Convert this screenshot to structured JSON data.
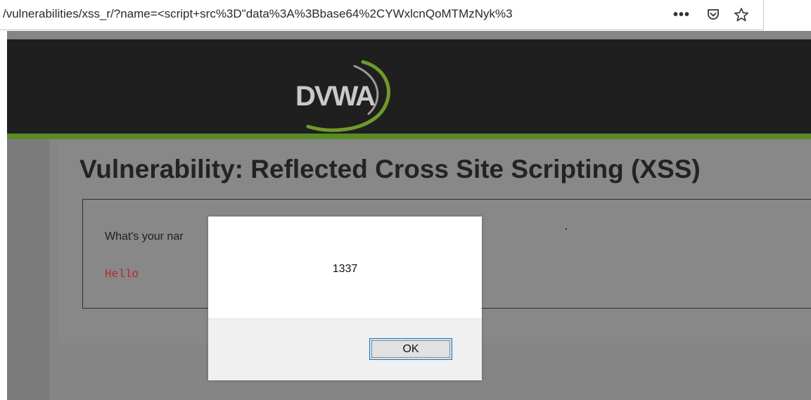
{
  "browser": {
    "url": "/vulnerabilities/xss_r/?name=<script+src%3D\"data%3A%3Bbase64%2CYWxlcnQoMTMzNyk%3",
    "icons": {
      "more": "more-actions-icon",
      "pocket": "pocket-icon",
      "bookmark": "bookmark-star-icon"
    }
  },
  "header": {
    "logo_text": "DVWA",
    "colors": {
      "bar": "#1f1f1f",
      "stripe": "#5a8c26"
    }
  },
  "main": {
    "title": "Vulnerability: Reflected Cross Site Scripting (XSS)",
    "question_visible": "What's your nar",
    "output": "Hello"
  },
  "alert": {
    "message": "1337",
    "ok_label": "OK"
  }
}
